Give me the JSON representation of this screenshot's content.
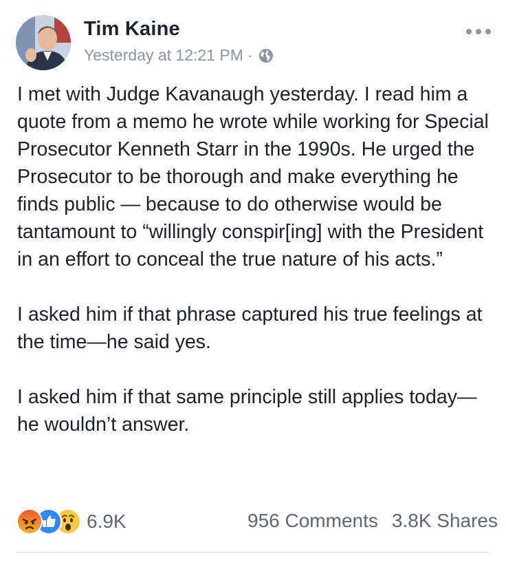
{
  "post": {
    "author": "Tim Kaine",
    "timestamp": "Yesterday at 12:21 PM",
    "separator": "·",
    "privacy_icon": "globe-icon",
    "menu_icon": "more-options-icon",
    "paragraphs": [
      "I met with Judge Kavanaugh yesterday. I read him a quote from a memo he wrote while working for Special Prosecutor Kenneth Starr in the 1990s. He urged the Prosecutor to be thorough and make everything he finds public — because to do otherwise would be tantamount to “willingly conspir[ing] with the President in an effort to conceal the true nature of his acts.”",
      "I asked him if that phrase captured his true feelings at the time—he said yes.",
      "I asked him if that same principle still applies today—he wouldn’t answer."
    ]
  },
  "engagement": {
    "reaction_icons": [
      "angry-reaction-icon",
      "like-reaction-icon",
      "wow-reaction-icon"
    ],
    "reaction_count": "6.9K",
    "comments": "956 Comments",
    "shares": "3.8K Shares"
  },
  "colors": {
    "text": "#1d2129",
    "muted": "#8d949e",
    "like_blue": "#2e89ff",
    "divider": "#dadde1"
  }
}
